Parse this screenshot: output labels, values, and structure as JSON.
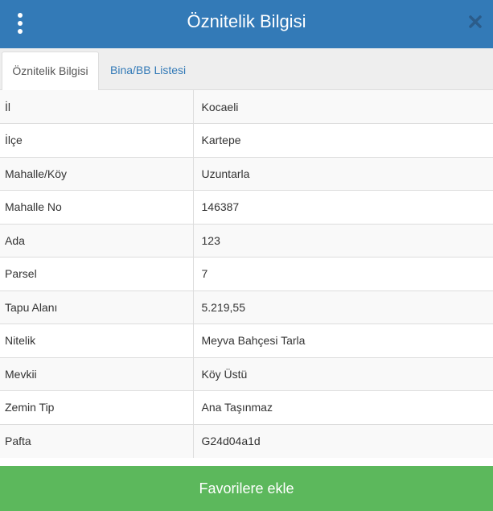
{
  "header": {
    "title": "Öznitelik Bilgisi",
    "menu_icon": "vertical-ellipsis-icon",
    "close_icon": "close-icon",
    "background": "#337ab7"
  },
  "tabs": [
    {
      "label": "Öznitelik Bilgisi",
      "active": true
    },
    {
      "label": "Bina/BB Listesi",
      "active": false
    }
  ],
  "attributes": [
    {
      "key": "İl",
      "value": "Kocaeli"
    },
    {
      "key": "İlçe",
      "value": "Kartepe"
    },
    {
      "key": "Mahalle/Köy",
      "value": "Uzuntarla"
    },
    {
      "key": "Mahalle No",
      "value": "146387"
    },
    {
      "key": "Ada",
      "value": "123"
    },
    {
      "key": "Parsel",
      "value": "7"
    },
    {
      "key": "Tapu Alanı",
      "value": "5.219,55"
    },
    {
      "key": "Nitelik",
      "value": "Meyva Bahçesi Tarla"
    },
    {
      "key": "Mevkii",
      "value": "Köy Üstü"
    },
    {
      "key": "Zemin Tip",
      "value": "Ana Taşınmaz"
    },
    {
      "key": "Pafta",
      "value": "G24d04a1d"
    }
  ],
  "footer": {
    "favorite_label": "Favorilere ekle",
    "background": "#5cb85c"
  }
}
